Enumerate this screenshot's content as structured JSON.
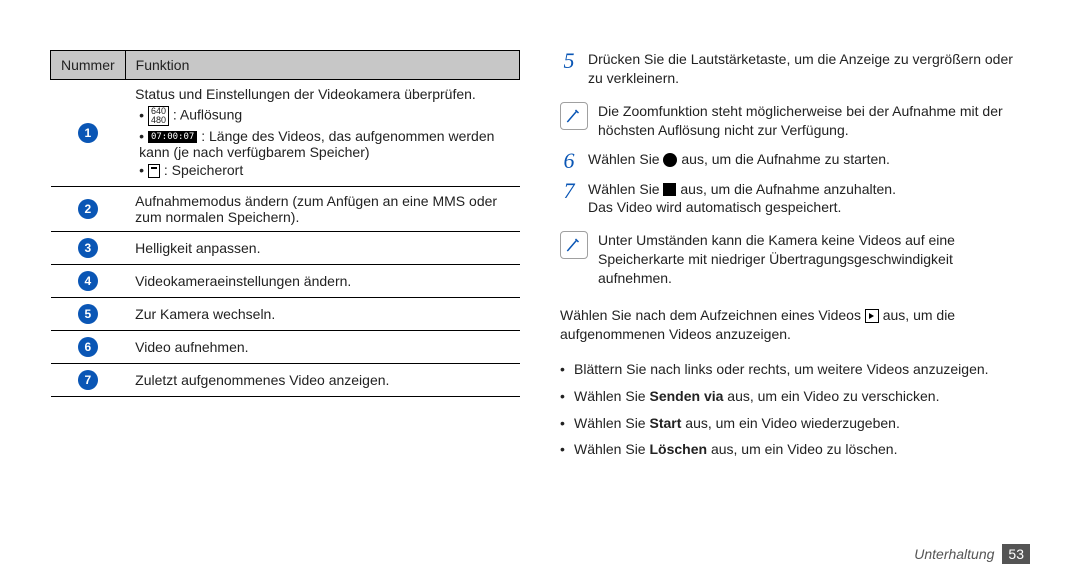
{
  "table": {
    "headers": {
      "number": "Nummer",
      "function": "Funktion"
    },
    "rows": [
      {
        "n": "1",
        "intro": "Status und Einstellungen der Videokamera überprüfen.",
        "items": [
          {
            "iconLabel": "640\n480",
            "text": " : Auflösung"
          },
          {
            "iconTimer": "07:00:07",
            "text": " : Länge des Videos, das aufgenommen werden kann (je nach verfügbarem Speicher)"
          },
          {
            "iconStorage": true,
            "text": " : Speicherort"
          }
        ]
      },
      {
        "n": "2",
        "text": "Aufnahmemodus ändern (zum Anfügen an eine MMS oder zum normalen Speichern)."
      },
      {
        "n": "3",
        "text": "Helligkeit anpassen."
      },
      {
        "n": "4",
        "text": "Videokameraeinstellungen ändern."
      },
      {
        "n": "5",
        "text": "Zur Kamera wechseln."
      },
      {
        "n": "6",
        "text": "Video aufnehmen."
      },
      {
        "n": "7",
        "text": "Zuletzt aufgenommenes Video anzeigen."
      }
    ]
  },
  "right": {
    "step5": "Drücken Sie die Lautstärketaste, um die Anzeige zu vergrößern oder zu verkleinern.",
    "note1": "Die Zoomfunktion steht möglicherweise bei der Aufnahme mit der höchsten Auflösung nicht zur Verfügung.",
    "step6_pre": "Wählen Sie ",
    "step6_post": " aus, um die Aufnahme zu starten.",
    "step7_pre": "Wählen Sie ",
    "step7_post": " aus, um die Aufnahme anzuhalten.",
    "step7_line2": "Das Video wird automatisch gespeichert.",
    "note2": "Unter Umständen kann die Kamera keine Videos auf eine Speicherkarte mit niedriger Übertragungsgeschwindigkeit aufnehmen.",
    "para_pre": "Wählen Sie nach dem Aufzeichnen eines Videos ",
    "para_post": " aus, um die aufgenommenen Videos anzuzeigen.",
    "bullets": {
      "b1": "Blättern Sie nach links oder rechts, um weitere Videos anzuzeigen.",
      "b2_pre": "Wählen Sie ",
      "b2_strong": "Senden via",
      "b2_post": " aus, um ein Video zu verschicken.",
      "b3_pre": "Wählen Sie ",
      "b3_strong": "Start",
      "b3_post": " aus, um ein Video wiederzugeben.",
      "b4_pre": "Wählen Sie ",
      "b4_strong": "Löschen",
      "b4_post": " aus, um ein Video zu löschen."
    }
  },
  "footer": {
    "section": "Unterhaltung",
    "page": "53"
  }
}
